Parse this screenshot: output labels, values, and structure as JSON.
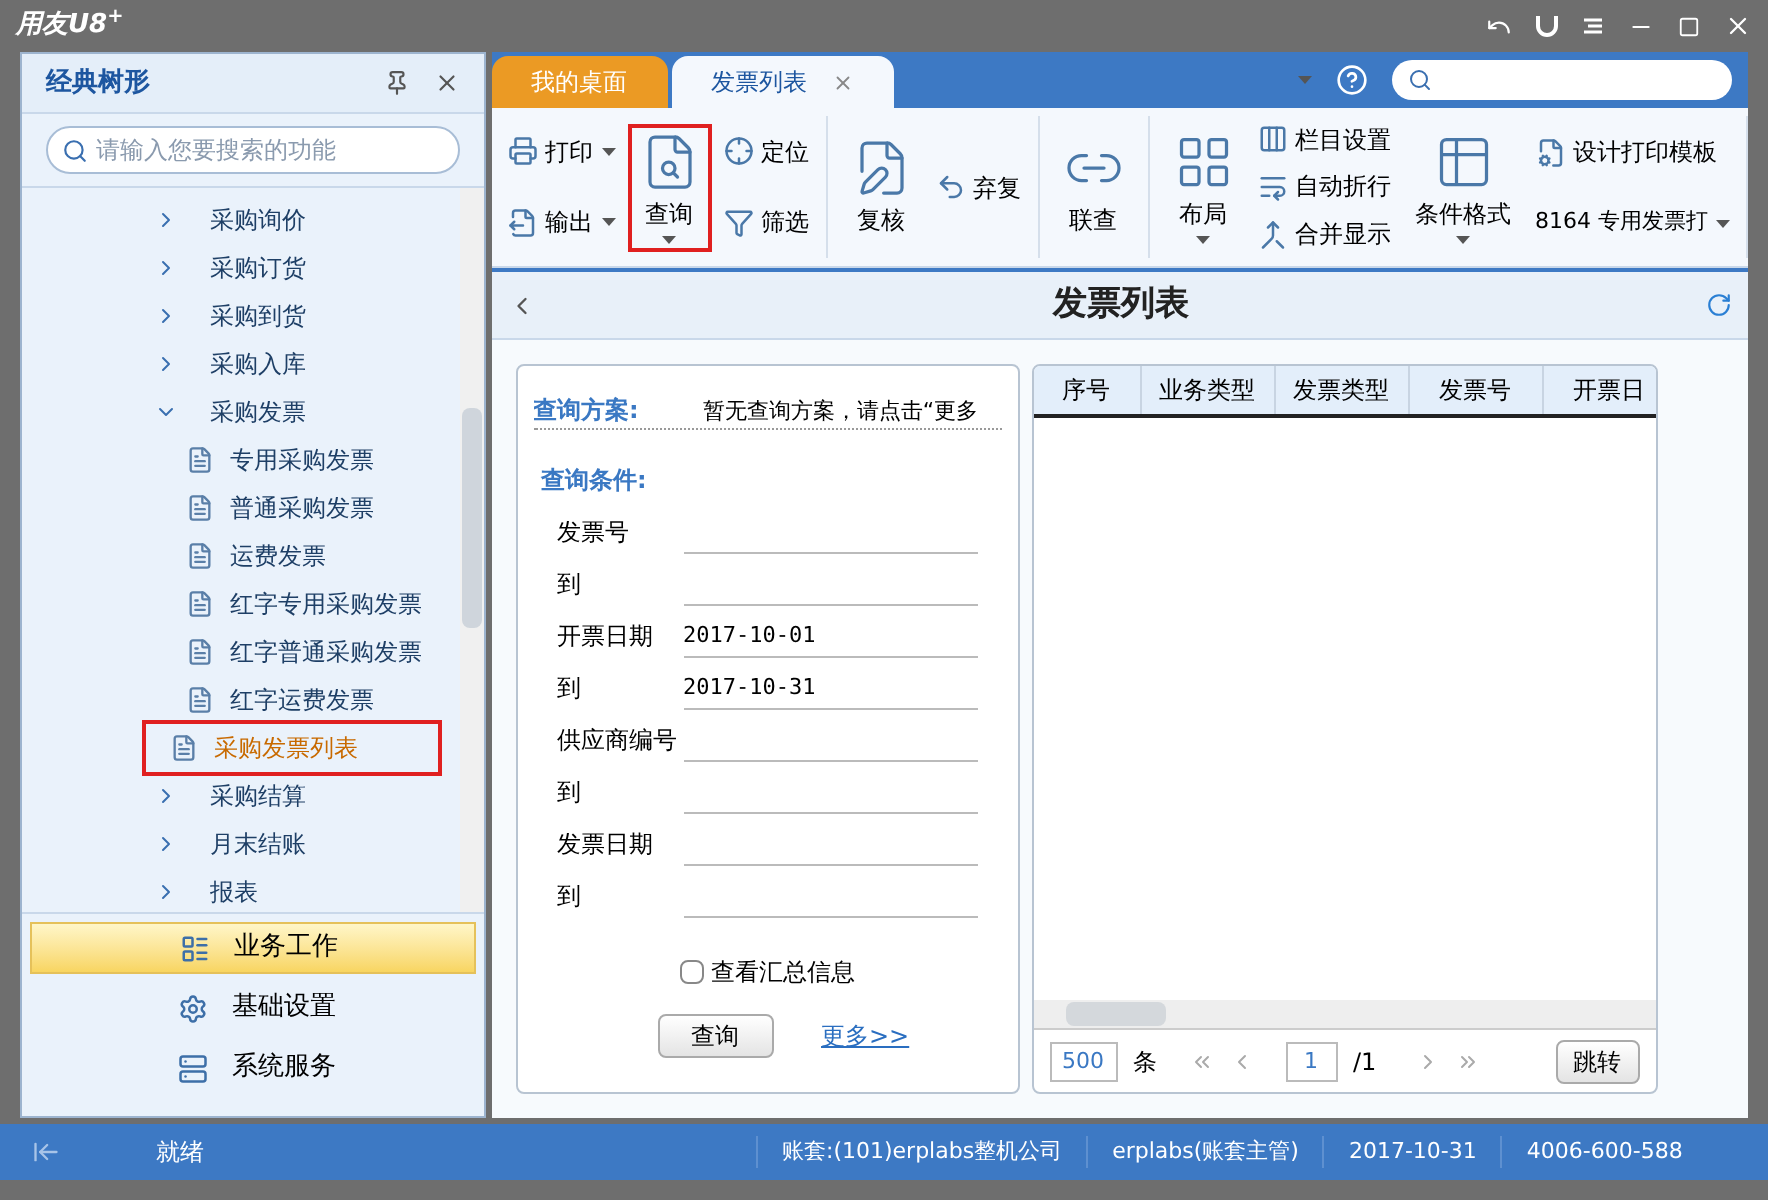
{
  "window": {
    "title": "用友U8$^{+}$"
  },
  "sidebar": {
    "title": "经典树形",
    "search": {
      "placeholder": "请输入您要搜索的功能"
    },
    "tree": [
      {
        "label": "采购询价",
        "expanded": false,
        "selected": false,
        "highlighted": false
      },
      {
        "label": "采购订货",
        "expanded": false,
        "selected": false,
        "highlighted": false
      },
      {
        "label": "采购到货",
        "expanded": false,
        "selected": false,
        "highlighted": false
      },
      {
        "label": "采购入库",
        "expanded": false,
        "selected": false,
        "highlighted": false
      },
      {
        "label": "采购发票",
        "expanded": true,
        "selected": false,
        "highlighted": false,
        "children": [
          {
            "label": "专用采购发票",
            "selected": false,
            "highlighted": false
          },
          {
            "label": "普通采购发票",
            "selected": false,
            "highlighted": false
          },
          {
            "label": "运费发票",
            "selected": false,
            "highlighted": false
          },
          {
            "label": "红字专用采购发票",
            "selected": false,
            "highlighted": false
          },
          {
            "label": "红字普通采购发票",
            "selected": false,
            "highlighted": false
          },
          {
            "label": "红字运费发票",
            "selected": false,
            "highlighted": false
          },
          {
            "label": "采购发票列表",
            "selected": true,
            "highlighted": true
          }
        ]
      },
      {
        "label": "采购结算",
        "expanded": false,
        "selected": false,
        "highlighted": false
      },
      {
        "label": "月末结账",
        "expanded": false,
        "selected": false,
        "highlighted": false
      },
      {
        "label": "报表",
        "expanded": false,
        "selected": false,
        "highlighted": false
      }
    ],
    "nav": [
      {
        "label": "业务工作",
        "selected": true
      },
      {
        "label": "基础设置",
        "selected": false
      },
      {
        "label": "系统服务",
        "selected": false
      }
    ]
  },
  "tabs": [
    {
      "label": "我的桌面",
      "selected": false
    },
    {
      "label": "发票列表",
      "selected": true
    }
  ],
  "toolbar": [
    {
      "columns": [
        [
          {
            "kind": "small",
            "label": "打印",
            "dropdown": true,
            "highlighted": false
          },
          {
            "kind": "small",
            "label": "输出",
            "dropdown": true,
            "highlighted": false
          }
        ],
        [
          {
            "kind": "large",
            "label": "查询",
            "dropdown": true,
            "highlighted": true
          }
        ],
        [
          {
            "kind": "small",
            "label": "定位",
            "dropdown": false,
            "highlighted": false
          },
          {
            "kind": "small",
            "label": "筛选",
            "dropdown": false,
            "highlighted": false
          }
        ]
      ]
    },
    {
      "columns": [
        [
          {
            "kind": "large",
            "label": "复核",
            "dropdown": false,
            "highlighted": false
          }
        ],
        [
          {
            "kind": "small",
            "label": "弃复",
            "dropdown": false,
            "highlighted": false
          }
        ]
      ]
    },
    {
      "columns": [
        [
          {
            "kind": "large",
            "label": "联查",
            "dropdown": false,
            "highlighted": false
          }
        ]
      ]
    },
    {
      "columns": [
        [
          {
            "kind": "large",
            "label": "布局",
            "dropdown": true,
            "highlighted": false
          }
        ],
        [
          {
            "kind": "small",
            "label": "栏目设置",
            "dropdown": false,
            "highlighted": false
          },
          {
            "kind": "small",
            "label": "自动折行",
            "dropdown": false,
            "highlighted": false
          },
          {
            "kind": "small",
            "label": "合并显示",
            "dropdown": false,
            "highlighted": false
          }
        ],
        [
          {
            "kind": "large",
            "label": "条件格式",
            "dropdown": true,
            "highlighted": false
          }
        ],
        [
          {
            "kind": "small",
            "label": "设计打印模板",
            "dropdown": false,
            "highlighted": false
          },
          {
            "kind": "select",
            "label": "8164 专用发票打",
            "dropdown": true,
            "highlighted": false
          }
        ]
      ]
    }
  ],
  "page": {
    "title": "发票列表"
  },
  "query": {
    "scheme_label": "查询方案:",
    "scheme_text": "暂无查询方案，请点击“更多",
    "conditions_label": "查询条件:",
    "conditions": [
      {
        "label": "发票号"
      },
      {
        "label": "到"
      },
      {
        "label": "开票日期",
        "value": "2017-10-01"
      },
      {
        "label": "到",
        "value": "2017-10-31"
      },
      {
        "label": "供应商编号"
      },
      {
        "label": "到"
      },
      {
        "label": "发票日期"
      },
      {
        "label": "到"
      }
    ],
    "summary": {
      "label": "查看汇总信息",
      "checked": false
    },
    "button": "查询",
    "more_link": "更多>>"
  },
  "table": {
    "columns": [
      "序号",
      "业务类型",
      "发票类型",
      "发票号",
      "开票日"
    ]
  },
  "pager": {
    "page_size": "500",
    "unit": "条",
    "page": "1",
    "total": "/1",
    "jump": "跳转"
  },
  "status_bar": {
    "ready": "就绪",
    "items": [
      "账套:(101)erplabs整机公司",
      "erplabs(账套主管)",
      "2017-10-31",
      "4006-600-588"
    ]
  }
}
